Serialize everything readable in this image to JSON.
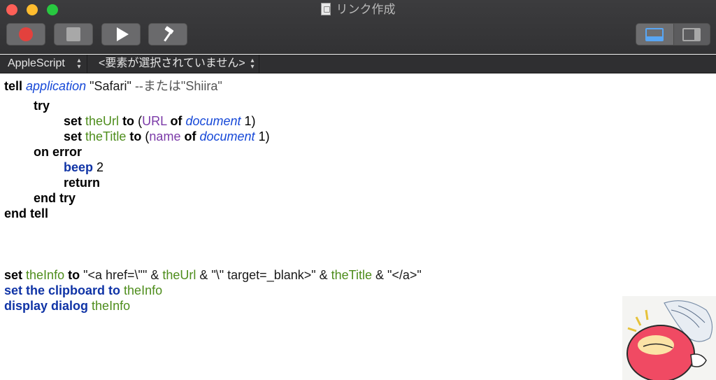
{
  "window": {
    "title": "リンク作成"
  },
  "toolbar": {
    "record_icon": "record-icon",
    "stop_icon": "stop-icon",
    "run_icon": "play-icon",
    "compile_icon": "hammer-icon",
    "view_toggle_icons": [
      "bottom-pane-icon",
      "side-pane-icon"
    ]
  },
  "navbar": {
    "language": "AppleScript",
    "element": "<要素が選択されていません>"
  },
  "colors": {
    "keyword": "#000000",
    "keyword_blue": "#1034a6",
    "application": "#1749d8",
    "variable": "#4e8d1c",
    "property": "#7b3aa8"
  },
  "code": {
    "l1": {
      "kw": "tell",
      "app": "application",
      "str": "\"Safari\"",
      "cmt": "--または\"Shiira\""
    },
    "l2": {
      "kw": "try"
    },
    "l3": {
      "kw": "set",
      "var": "theUrl",
      "kw2": "to",
      "p1": "(",
      "prop": "URL",
      "kw3": "of",
      "app": "document",
      "end": "1)"
    },
    "l4": {
      "kw": "set",
      "var": "theTitle",
      "kw2": "to",
      "p1": "(",
      "prop": "name",
      "kw3": "of",
      "app": "document",
      "end": "1)"
    },
    "l5": {
      "kw": "on error"
    },
    "l6": {
      "kw": "beep",
      "num": "2"
    },
    "l7": {
      "kw": "return"
    },
    "l8": {
      "kw": "end try"
    },
    "l9": {
      "kw": "end tell"
    },
    "l10": {
      "kw": "set",
      "var": "theInfo",
      "kw2": "to",
      "s1": "\"<a href=\\\"\" & ",
      "v2": "theUrl",
      "s2": " & \"\\\" target=_blank>\" & ",
      "v3": "theTitle",
      "s3": " & \"</a>\""
    },
    "l11": {
      "kw": "set the clipboard to",
      "var": "theInfo"
    },
    "l12": {
      "kw": "display dialog",
      "var": "theInfo"
    }
  }
}
